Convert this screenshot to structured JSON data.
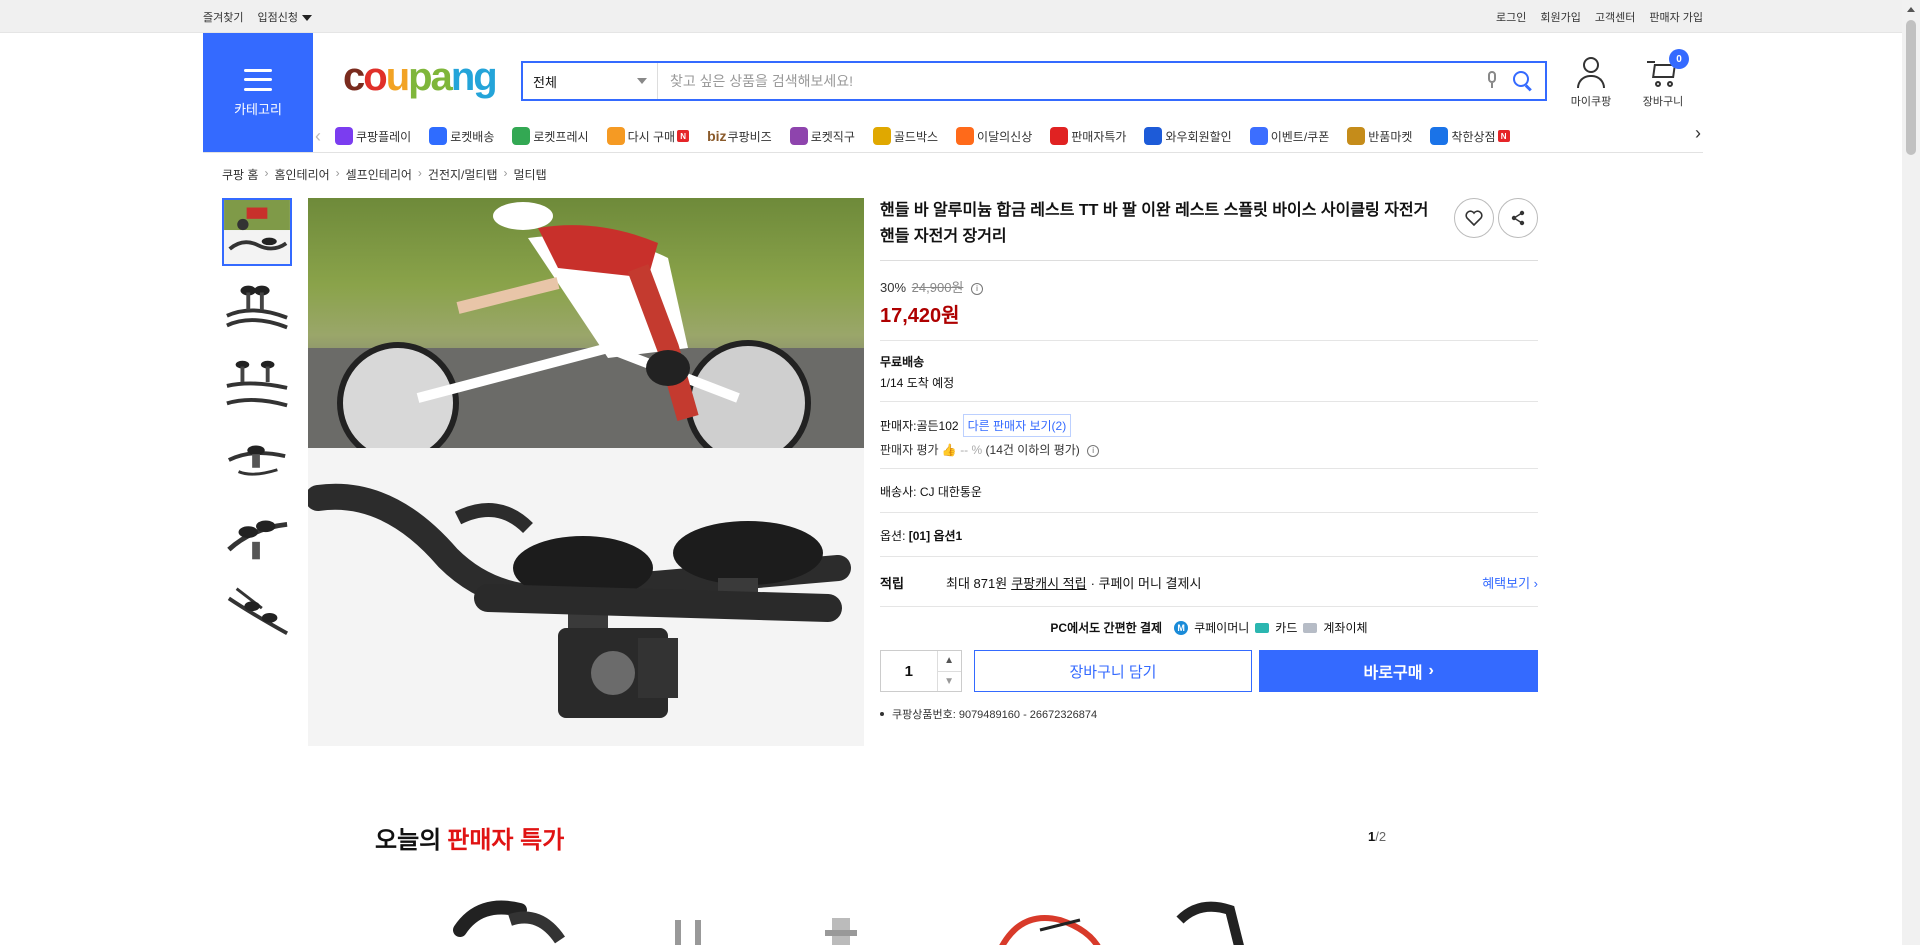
{
  "topbar": {
    "left": [
      "즐겨찾기",
      "입점신청"
    ],
    "right": [
      "로그인",
      "회원가입",
      "고객센터",
      "판매자 가입"
    ]
  },
  "header": {
    "category_label": "카테고리",
    "logo_parts": [
      "c",
      "o",
      "u",
      "pa",
      "ng"
    ],
    "search_select": "전체",
    "search_placeholder": "찾고 싶은 상품을 검색해보세요!",
    "my_label": "마이쿠팡",
    "cart_label": "장바구니",
    "cart_count": "0"
  },
  "nav": [
    {
      "label": "쿠팡플레이",
      "icon": "play-icon",
      "color": "#7b3df0"
    },
    {
      "label": "로켓배송",
      "icon": "rocket-icon",
      "color": "#2f6cff"
    },
    {
      "label": "로켓프레시",
      "icon": "rocket-fresh-icon",
      "color": "#33a853"
    },
    {
      "label": "다시 구매",
      "icon": "rebuy-icon",
      "color": "#f59a23",
      "badge": "N"
    },
    {
      "label": "쿠팡비즈",
      "icon": "biz-icon",
      "color": "#8a5a2b",
      "prefix": "biz"
    },
    {
      "label": "로켓직구",
      "icon": "rocket-global-icon",
      "color": "#8e44ad"
    },
    {
      "label": "골드박스",
      "icon": "goldbox-icon",
      "color": "#e0a800"
    },
    {
      "label": "이달의신상",
      "icon": "new-icon",
      "color": "#ff6a1a"
    },
    {
      "label": "판매자특가",
      "icon": "percent-icon",
      "color": "#e02222"
    },
    {
      "label": "와우회원할인",
      "icon": "wow-icon",
      "color": "#1d5bd8"
    },
    {
      "label": "이벤트/쿠폰",
      "icon": "coupon-icon",
      "color": "#3c6eff"
    },
    {
      "label": "반품마켓",
      "icon": "return-market-icon",
      "color": "#c58c1a"
    },
    {
      "label": "착한상점",
      "icon": "good-store-icon",
      "color": "#1a73e8",
      "badge": "N"
    }
  ],
  "breadcrumb": [
    "쿠팡 홈",
    "홈인테리어",
    "셀프인테리어",
    "건전지/멀티탭",
    "멀티탭"
  ],
  "product": {
    "title": "핸들 바 알루미늄 합금 레스트 TT 바 팔 이완 레스트 스플릿 바이스 사이클링 자전거 핸들 자전거 장거리",
    "discount": "30%",
    "original_price": "24,900원",
    "sale_price": "17,420원",
    "shipping_label": "무료배송",
    "arrival": "1/14 도착 예정",
    "seller_prefix": "판매자:",
    "seller_name": "골든102",
    "other_sellers": "다른 판매자 보기(2)",
    "rating_label": "판매자 평가",
    "rating_value": "-- %",
    "rating_note": "(14건 이하의 평가)",
    "carrier_label": "배송사:",
    "carrier": "CJ 대한통운",
    "option_label": "옵션:",
    "option_value": "[01] 옵션1",
    "reward_label": "적립",
    "reward_prefix": "최대 871원",
    "reward_link": "쿠팡캐시 적립",
    "reward_suffix": "· 쿠페이 머니 결제시",
    "benefit_link": "혜택보기",
    "pay_title": "PC에서도 간편한 결제",
    "pay_methods": [
      "쿠페이머니",
      "카드",
      "계좌이체"
    ],
    "quantity": "1",
    "cart_button": "장바구니 담기",
    "buy_button": "바로구매",
    "product_no": "쿠팡상품번호: 9079489160 - 26672326874"
  },
  "deals": {
    "title_prefix": "오늘의",
    "title_highlight": "판매자 특가",
    "page_current": "1",
    "page_total": "/2"
  },
  "colors": {
    "brand_blue": "#346aff",
    "price_red": "#ae0000",
    "deal_red": "#e01313"
  }
}
